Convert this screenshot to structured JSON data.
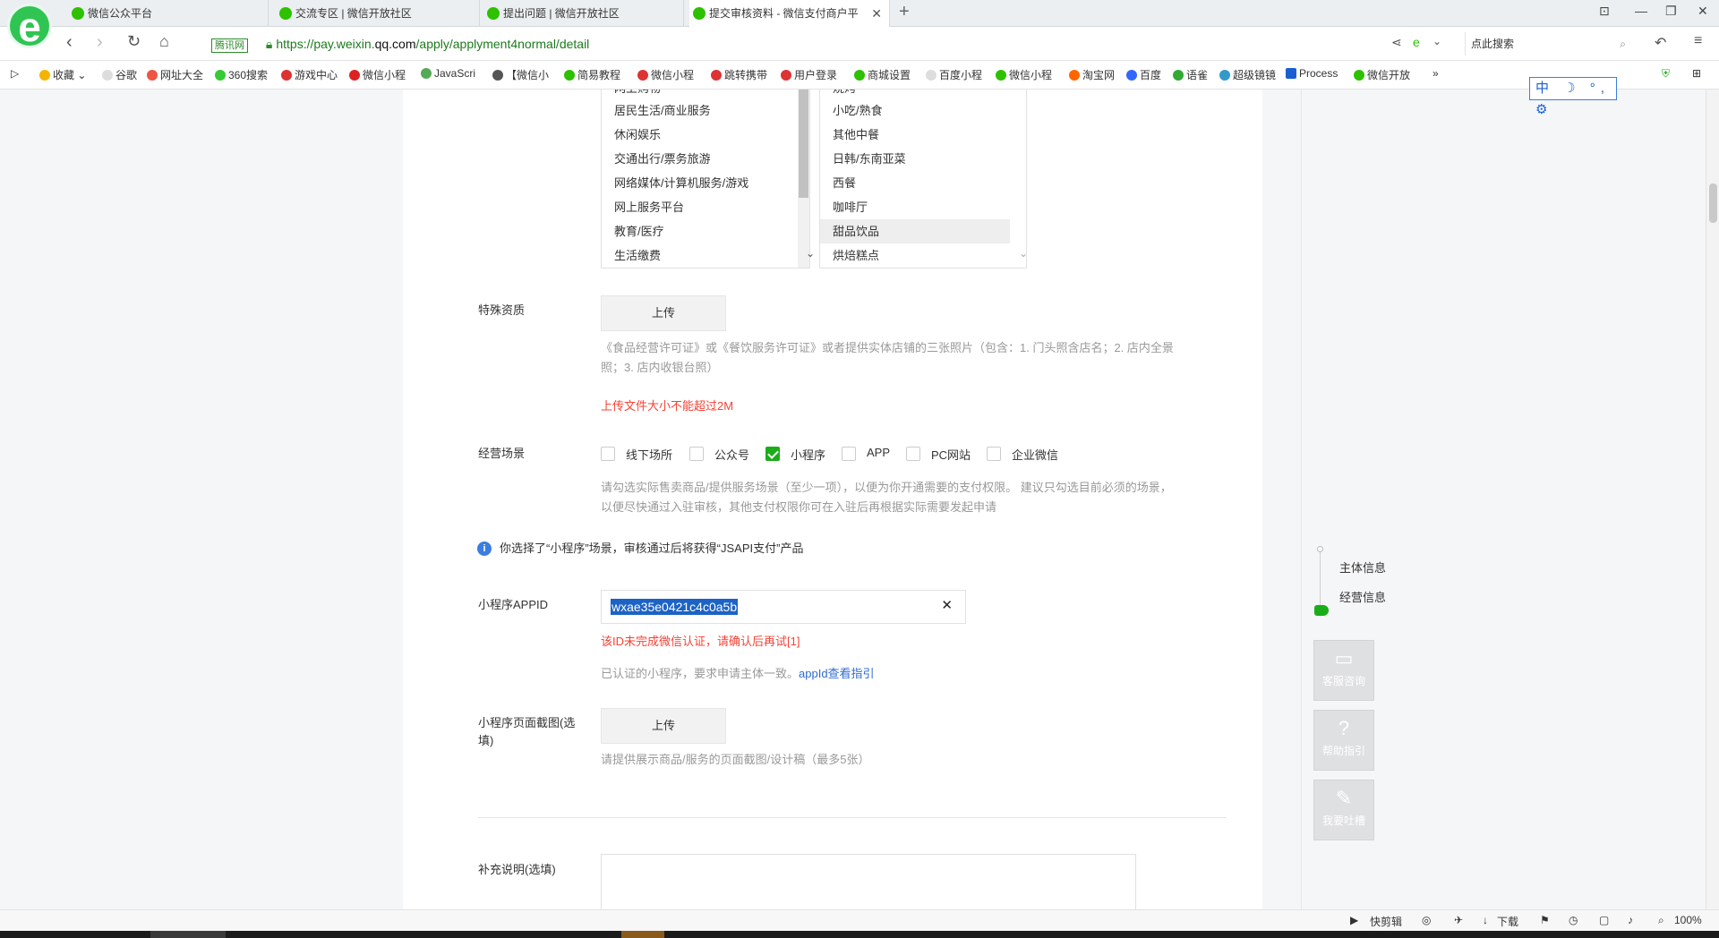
{
  "browser": {
    "tabs": [
      {
        "title": "微信公众平台",
        "active": false
      },
      {
        "title": "交流专区 | 微信开放社区",
        "active": false
      },
      {
        "title": "提出问题 | 微信开放社区",
        "active": false
      },
      {
        "title": "提交审核资料 - 微信支付商户平",
        "active": true
      }
    ],
    "cert_label": "腾讯网",
    "url_prefix": "https://pay.weixin.",
    "url_domain": "qq.com",
    "url_path": "/apply/applyment4normal/detail",
    "search_placeholder": "点此搜索"
  },
  "bookmarks": [
    "收藏",
    "谷歌",
    "网址大全",
    "360搜索",
    "游戏中心",
    "微信小程",
    "JavaScri",
    "【微信小",
    "简易教程",
    "微信小程",
    "跳转携带",
    "用户登录",
    "商城设置",
    "百度小程",
    "微信小程",
    "淘宝网",
    "百度",
    "语雀",
    "超级镜镜",
    "Process",
    "微信开放"
  ],
  "ime": {
    "label": "中 ☽ °, ⚙"
  },
  "categories": {
    "left": [
      "网上购物",
      "居民生活/商业服务",
      "休闲娱乐",
      "交通出行/票务旅游",
      "网络媒体/计算机服务/游戏",
      "网上服务平台",
      "教育/医疗",
      "生活缴费"
    ],
    "right": [
      "烧烤",
      "小吃/熟食",
      "其他中餐",
      "日韩/东南亚菜",
      "西餐",
      "咖啡厅",
      "甜品饮品",
      "烘焙糕点"
    ],
    "right_selected": "甜品饮品"
  },
  "special_qual": {
    "label": "特殊资质",
    "upload_label": "上传",
    "hint_line1": "《食品经营许可证》或《餐饮服务许可证》或者提供实体店铺的三张照片（包含：1. 门头照含店名；2. 店内全景",
    "hint_line2": "照；3. 店内收银台照）",
    "error": "上传文件大小不能超过2M"
  },
  "scenes": {
    "label": "经营场景",
    "options": [
      {
        "label": "线下场所",
        "checked": false
      },
      {
        "label": "公众号",
        "checked": false
      },
      {
        "label": "小程序",
        "checked": true
      },
      {
        "label": "APP",
        "checked": false
      },
      {
        "label": "PC网站",
        "checked": false
      },
      {
        "label": "企业微信",
        "checked": false
      }
    ],
    "hint_line1": "请勾选实际售卖商品/提供服务场景（至少一项），以便为你开通需要的支付权限。 建议只勾选目前必须的场景，",
    "hint_line2": "以便尽快通过入驻审核，其他支付权限你可在入驻后再根据实际需要发起申请",
    "info": "你选择了“小程序”场景，审核通过后将获得“JSAPI支付”产品"
  },
  "appid": {
    "label": "小程序APPID",
    "value": "wxae35e0421c4c0a5b",
    "clear": "✕",
    "error": "该ID未完成微信认证，请确认后再试[1]",
    "hint": "已认证的小程序，要求申请主体一致。",
    "hint_link": "appId查看指引"
  },
  "screenshot": {
    "label_line1": "小程序页面截图(选",
    "label_line2": "填)",
    "upload_label": "上传",
    "hint": "请提供展示商品/服务的页面截图/设计稿（最多5张）"
  },
  "notes": {
    "label": "补充说明(选填)"
  },
  "steps": [
    {
      "label": "主体信息"
    },
    {
      "label": "经营信息"
    }
  ],
  "side_buttons": [
    {
      "label": "客服咨询",
      "icon": "chat-icon"
    },
    {
      "label": "帮助指引",
      "icon": "help-icon"
    },
    {
      "label": "我要吐槽",
      "icon": "edit-icon"
    }
  ],
  "statusbar": {
    "clip": "快剪辑",
    "download": "下载",
    "zoom": "100%"
  }
}
